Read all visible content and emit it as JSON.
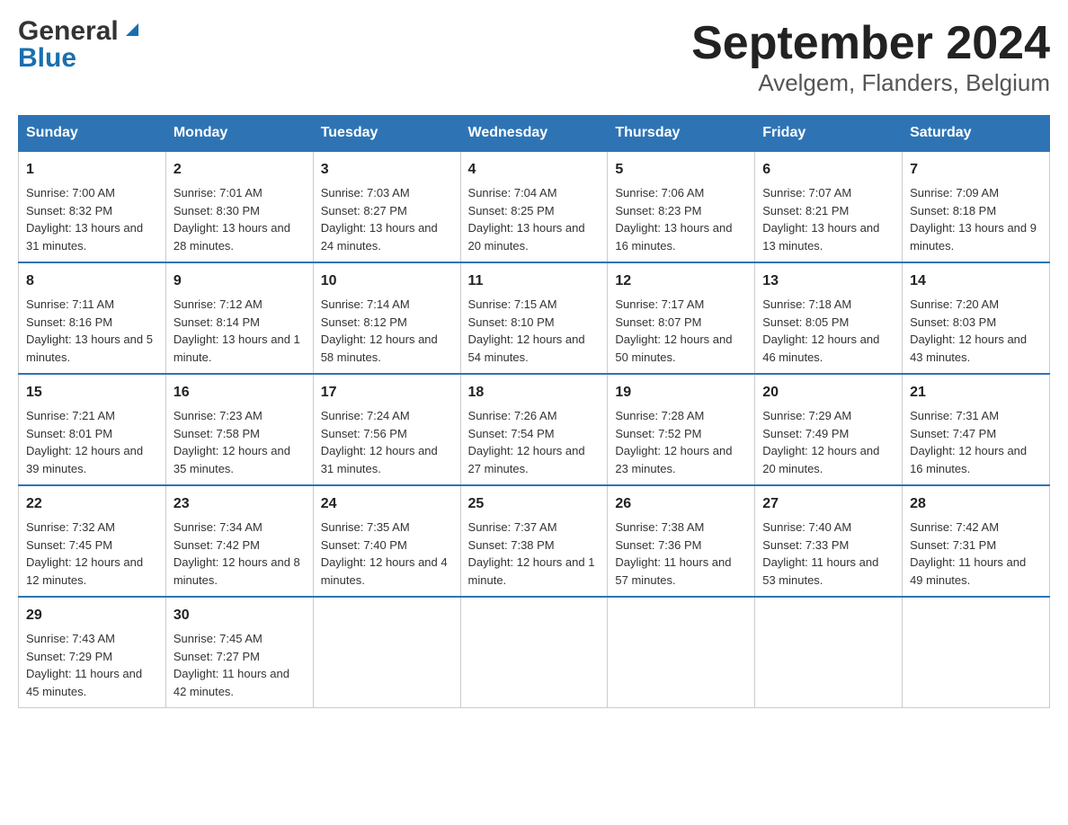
{
  "logo": {
    "general": "General",
    "blue": "Blue"
  },
  "title": "September 2024",
  "subtitle": "Avelgem, Flanders, Belgium",
  "headers": [
    "Sunday",
    "Monday",
    "Tuesday",
    "Wednesday",
    "Thursday",
    "Friday",
    "Saturday"
  ],
  "weeks": [
    [
      {
        "day": "1",
        "sunrise": "Sunrise: 7:00 AM",
        "sunset": "Sunset: 8:32 PM",
        "daylight": "Daylight: 13 hours and 31 minutes."
      },
      {
        "day": "2",
        "sunrise": "Sunrise: 7:01 AM",
        "sunset": "Sunset: 8:30 PM",
        "daylight": "Daylight: 13 hours and 28 minutes."
      },
      {
        "day": "3",
        "sunrise": "Sunrise: 7:03 AM",
        "sunset": "Sunset: 8:27 PM",
        "daylight": "Daylight: 13 hours and 24 minutes."
      },
      {
        "day": "4",
        "sunrise": "Sunrise: 7:04 AM",
        "sunset": "Sunset: 8:25 PM",
        "daylight": "Daylight: 13 hours and 20 minutes."
      },
      {
        "day": "5",
        "sunrise": "Sunrise: 7:06 AM",
        "sunset": "Sunset: 8:23 PM",
        "daylight": "Daylight: 13 hours and 16 minutes."
      },
      {
        "day": "6",
        "sunrise": "Sunrise: 7:07 AM",
        "sunset": "Sunset: 8:21 PM",
        "daylight": "Daylight: 13 hours and 13 minutes."
      },
      {
        "day": "7",
        "sunrise": "Sunrise: 7:09 AM",
        "sunset": "Sunset: 8:18 PM",
        "daylight": "Daylight: 13 hours and 9 minutes."
      }
    ],
    [
      {
        "day": "8",
        "sunrise": "Sunrise: 7:11 AM",
        "sunset": "Sunset: 8:16 PM",
        "daylight": "Daylight: 13 hours and 5 minutes."
      },
      {
        "day": "9",
        "sunrise": "Sunrise: 7:12 AM",
        "sunset": "Sunset: 8:14 PM",
        "daylight": "Daylight: 13 hours and 1 minute."
      },
      {
        "day": "10",
        "sunrise": "Sunrise: 7:14 AM",
        "sunset": "Sunset: 8:12 PM",
        "daylight": "Daylight: 12 hours and 58 minutes."
      },
      {
        "day": "11",
        "sunrise": "Sunrise: 7:15 AM",
        "sunset": "Sunset: 8:10 PM",
        "daylight": "Daylight: 12 hours and 54 minutes."
      },
      {
        "day": "12",
        "sunrise": "Sunrise: 7:17 AM",
        "sunset": "Sunset: 8:07 PM",
        "daylight": "Daylight: 12 hours and 50 minutes."
      },
      {
        "day": "13",
        "sunrise": "Sunrise: 7:18 AM",
        "sunset": "Sunset: 8:05 PM",
        "daylight": "Daylight: 12 hours and 46 minutes."
      },
      {
        "day": "14",
        "sunrise": "Sunrise: 7:20 AM",
        "sunset": "Sunset: 8:03 PM",
        "daylight": "Daylight: 12 hours and 43 minutes."
      }
    ],
    [
      {
        "day": "15",
        "sunrise": "Sunrise: 7:21 AM",
        "sunset": "Sunset: 8:01 PM",
        "daylight": "Daylight: 12 hours and 39 minutes."
      },
      {
        "day": "16",
        "sunrise": "Sunrise: 7:23 AM",
        "sunset": "Sunset: 7:58 PM",
        "daylight": "Daylight: 12 hours and 35 minutes."
      },
      {
        "day": "17",
        "sunrise": "Sunrise: 7:24 AM",
        "sunset": "Sunset: 7:56 PM",
        "daylight": "Daylight: 12 hours and 31 minutes."
      },
      {
        "day": "18",
        "sunrise": "Sunrise: 7:26 AM",
        "sunset": "Sunset: 7:54 PM",
        "daylight": "Daylight: 12 hours and 27 minutes."
      },
      {
        "day": "19",
        "sunrise": "Sunrise: 7:28 AM",
        "sunset": "Sunset: 7:52 PM",
        "daylight": "Daylight: 12 hours and 23 minutes."
      },
      {
        "day": "20",
        "sunrise": "Sunrise: 7:29 AM",
        "sunset": "Sunset: 7:49 PM",
        "daylight": "Daylight: 12 hours and 20 minutes."
      },
      {
        "day": "21",
        "sunrise": "Sunrise: 7:31 AM",
        "sunset": "Sunset: 7:47 PM",
        "daylight": "Daylight: 12 hours and 16 minutes."
      }
    ],
    [
      {
        "day": "22",
        "sunrise": "Sunrise: 7:32 AM",
        "sunset": "Sunset: 7:45 PM",
        "daylight": "Daylight: 12 hours and 12 minutes."
      },
      {
        "day": "23",
        "sunrise": "Sunrise: 7:34 AM",
        "sunset": "Sunset: 7:42 PM",
        "daylight": "Daylight: 12 hours and 8 minutes."
      },
      {
        "day": "24",
        "sunrise": "Sunrise: 7:35 AM",
        "sunset": "Sunset: 7:40 PM",
        "daylight": "Daylight: 12 hours and 4 minutes."
      },
      {
        "day": "25",
        "sunrise": "Sunrise: 7:37 AM",
        "sunset": "Sunset: 7:38 PM",
        "daylight": "Daylight: 12 hours and 1 minute."
      },
      {
        "day": "26",
        "sunrise": "Sunrise: 7:38 AM",
        "sunset": "Sunset: 7:36 PM",
        "daylight": "Daylight: 11 hours and 57 minutes."
      },
      {
        "day": "27",
        "sunrise": "Sunrise: 7:40 AM",
        "sunset": "Sunset: 7:33 PM",
        "daylight": "Daylight: 11 hours and 53 minutes."
      },
      {
        "day": "28",
        "sunrise": "Sunrise: 7:42 AM",
        "sunset": "Sunset: 7:31 PM",
        "daylight": "Daylight: 11 hours and 49 minutes."
      }
    ],
    [
      {
        "day": "29",
        "sunrise": "Sunrise: 7:43 AM",
        "sunset": "Sunset: 7:29 PM",
        "daylight": "Daylight: 11 hours and 45 minutes."
      },
      {
        "day": "30",
        "sunrise": "Sunrise: 7:45 AM",
        "sunset": "Sunset: 7:27 PM",
        "daylight": "Daylight: 11 hours and 42 minutes."
      },
      null,
      null,
      null,
      null,
      null
    ]
  ]
}
